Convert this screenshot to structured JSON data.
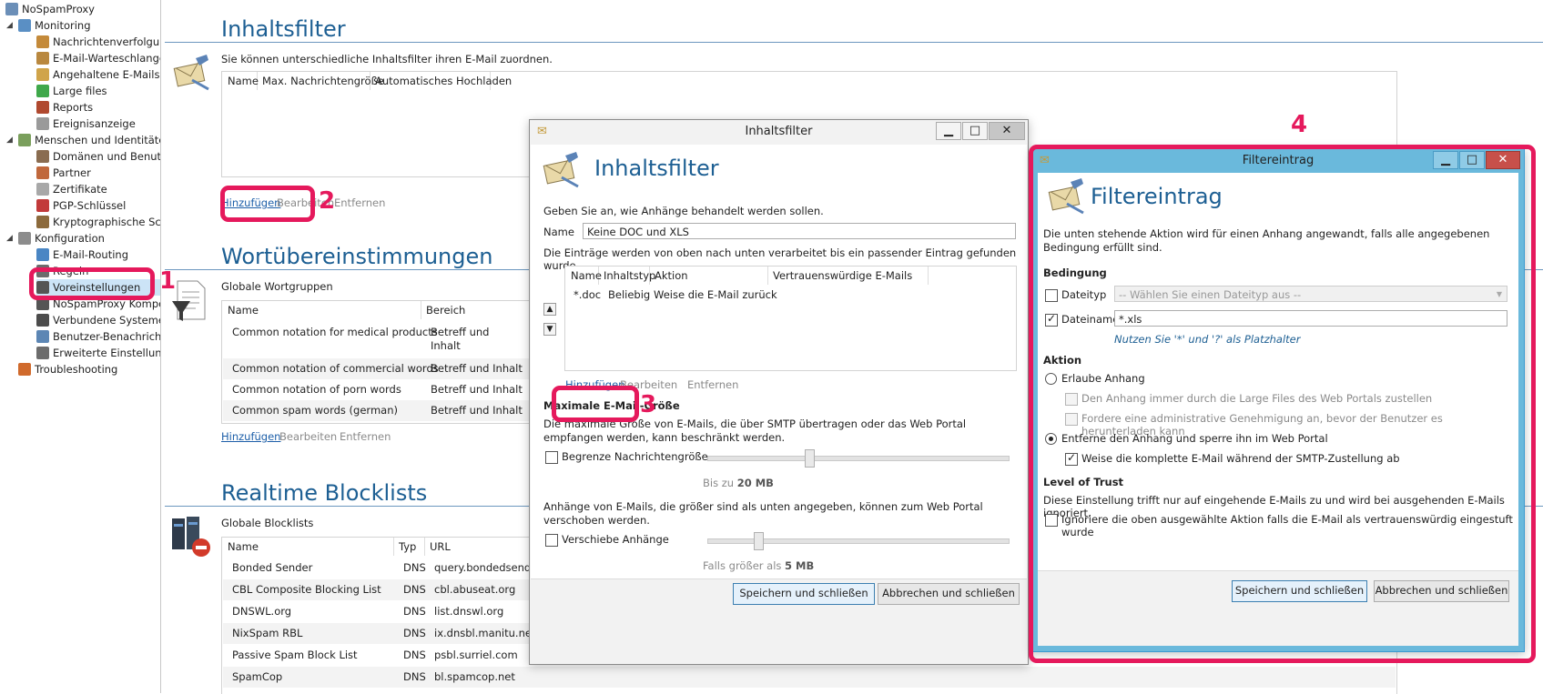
{
  "tree": [
    {
      "label": "NoSpamProxy",
      "indent": 0,
      "color": "#6b8fb8",
      "expander": ""
    },
    {
      "label": "Monitoring",
      "indent": 1,
      "color": "#5a8fc4",
      "expander": "◢"
    },
    {
      "label": "Nachrichtenverfolgung",
      "indent": 2,
      "color": "#c48a3a",
      "expander": ""
    },
    {
      "label": "E-Mail-Warteschlangen",
      "indent": 2,
      "color": "#b9883f",
      "expander": ""
    },
    {
      "label": "Angehaltene E-Mails",
      "indent": 2,
      "color": "#d0a44a",
      "expander": ""
    },
    {
      "label": "Large files",
      "indent": 2,
      "color": "#3fa84a",
      "expander": ""
    },
    {
      "label": "Reports",
      "indent": 2,
      "color": "#b0492f",
      "expander": ""
    },
    {
      "label": "Ereignisanzeige",
      "indent": 2,
      "color": "#9a9a9a",
      "expander": ""
    },
    {
      "label": "Menschen und Identitäten",
      "indent": 1,
      "color": "#7a9f5c",
      "expander": "◢"
    },
    {
      "label": "Domänen und Benutzer",
      "indent": 2,
      "color": "#8a6c50",
      "expander": ""
    },
    {
      "label": "Partner",
      "indent": 2,
      "color": "#c0683c",
      "expander": ""
    },
    {
      "label": "Zertifikate",
      "indent": 2,
      "color": "#a8a8a8",
      "expander": ""
    },
    {
      "label": "PGP-Schlüssel",
      "indent": 2,
      "color": "#c23a3a",
      "expander": ""
    },
    {
      "label": "Kryptographische Schlüssel",
      "indent": 2,
      "color": "#8c6a3c",
      "expander": ""
    },
    {
      "label": "Konfiguration",
      "indent": 1,
      "color": "#8c8c8c",
      "expander": "◢"
    },
    {
      "label": "E-Mail-Routing",
      "indent": 2,
      "color": "#4a86c4",
      "expander": ""
    },
    {
      "label": "Regeln",
      "indent": 2,
      "color": "#6c6c6c",
      "expander": ""
    },
    {
      "label": "Voreinstellungen",
      "indent": 2,
      "color": "#555555",
      "expander": "",
      "selected": true
    },
    {
      "label": "NoSpamProxy Komponenten",
      "indent": 2,
      "color": "#555555",
      "expander": ""
    },
    {
      "label": "Verbundene Systeme",
      "indent": 2,
      "color": "#4c4c4c",
      "expander": ""
    },
    {
      "label": "Benutzer-Benachrichtigungen",
      "indent": 2,
      "color": "#5c86b4",
      "expander": ""
    },
    {
      "label": "Erweiterte Einstellungen",
      "indent": 2,
      "color": "#6c6c6c",
      "expander": ""
    },
    {
      "label": "Troubleshooting",
      "indent": 1,
      "color": "#d06a2c",
      "expander": ""
    }
  ],
  "main": {
    "inhaltsfilter": {
      "title": "Inhaltsfilter",
      "description": "Sie können unterschiedliche Inhaltsfilter ihren E-Mail zuordnen.",
      "columns": [
        "Name",
        "Max. Nachrichtengröße",
        "Automatisches Hochladen"
      ],
      "add": "Hinzufügen",
      "edit": "Bearbeiten",
      "remove": "Entfernen"
    },
    "wort": {
      "title": "Wortübereinstimmungen",
      "subtitle": "Globale Wortgruppen",
      "columns": [
        "Name",
        "Bereich"
      ],
      "rows": [
        {
          "name": "Common notation for medical products",
          "scope": "Betreff und Inhalt"
        },
        {
          "name": "Common notation of commercial words",
          "scope": "Betreff und Inhalt"
        },
        {
          "name": "Common notation of porn words",
          "scope": "Betreff und Inhalt"
        },
        {
          "name": "Common spam words (german)",
          "scope": "Betreff und Inhalt"
        }
      ],
      "add": "Hinzufügen",
      "edit": "Bearbeiten",
      "remove": "Entfernen"
    },
    "rbl": {
      "title": "Realtime Blocklists",
      "subtitle": "Globale Blocklists",
      "columns": [
        "Name",
        "Typ",
        "URL"
      ],
      "rows": [
        {
          "name": "Bonded Sender",
          "type": "DNS",
          "url": "query.bondedsender.org"
        },
        {
          "name": "CBL Composite Blocking List",
          "type": "DNS",
          "url": "cbl.abuseat.org"
        },
        {
          "name": "DNSWL.org",
          "type": "DNS",
          "url": "list.dnswl.org"
        },
        {
          "name": "NixSpam RBL",
          "type": "DNS",
          "url": "ix.dnsbl.manitu.net"
        },
        {
          "name": "Passive Spam Block List",
          "type": "DNS",
          "url": "psbl.surriel.com"
        },
        {
          "name": "SpamCop",
          "type": "DNS",
          "url": "bl.spamcop.net"
        }
      ]
    }
  },
  "dialog1": {
    "window_title": "Inhaltsfilter",
    "heading": "Inhaltsfilter",
    "intro": "Geben Sie an, wie Anhänge behandelt werden sollen.",
    "name_label": "Name",
    "name_value": "Keine DOC und XLS",
    "order_text": "Die Einträge werden von oben nach unten verarbeitet bis ein passender Eintrag gefunden wurde.",
    "columns": [
      "Name",
      "Inhaltstyp",
      "Aktion",
      "Vertrauenswürdige E-Mails"
    ],
    "rows": [
      {
        "name": "*.doc",
        "type": "Beliebig",
        "action": "Weise die E-Mail zurück",
        "trusted": ""
      }
    ],
    "add": "Hinzufügen",
    "edit": "Bearbeiten",
    "remove": "Entfernen",
    "max_heading": "Maximale E-Mail-Größe",
    "max_text": "Die maximale Größe von E-Mails, die über SMTP übertragen oder das Web Portal empfangen werden, kann beschränkt werden.",
    "limit_label": "Begrenze Nachrichtengröße",
    "limit_prefix": "Bis zu ",
    "limit_value": "20 MB",
    "limit_fraction": 0.34,
    "attach_text": "Anhänge von E-Mails, die größer sind als unten angegeben, können zum Web Portal verschoben werden.",
    "move_label": "Verschiebe Anhänge",
    "move_prefix": "Falls größer als ",
    "move_value": "5 MB",
    "move_fraction": 0.17,
    "save": "Speichern und schließen",
    "cancel": "Abbrechen und schließen",
    "min": "▁",
    "max": "□",
    "close": "✕"
  },
  "dialog2": {
    "window_title": "Filtereintrag",
    "heading": "Filtereintrag",
    "intro": "Die unten stehende Aktion wird für einen Anhang angewandt, falls alle angegebenen Bedingung erfüllt sind.",
    "cond_heading": "Bedingung",
    "filetype_label": "Dateityp",
    "filetype_placeholder": "-- Wählen Sie einen Dateityp aus --",
    "filename_label": "Dateiname",
    "filename_value": "*.xls",
    "wildcard_hint": "Nutzen Sie '*' und '?' als Platzhalter",
    "action_heading": "Aktion",
    "allow_label": "Erlaube Anhang",
    "large_files_label": "Den Anhang immer durch die Large Files des Web Portals zustellen",
    "approval_label": "Fordere eine administrative Genehmigung an, bevor der Benutzer es herunterladen kann",
    "remove_label": "Entferne den Anhang und sperre ihn im Web Portal",
    "reject_label": "Weise die komplette E-Mail während der SMTP-Zustellung ab",
    "trust_heading": "Level of Trust",
    "trust_text": "Diese Einstellung trifft nur auf eingehende E-Mails zu und wird bei ausgehenden E-Mails ignoriert.",
    "ignore_label": "Ignoriere die oben ausgewählte Aktion falls die E-Mail als vertrauenswürdig eingestuft wurde",
    "save": "Speichern und schließen",
    "cancel": "Abbrechen und schließen",
    "min": "▁",
    "max": "□",
    "close": "✕"
  },
  "annotations": {
    "n1": "1",
    "n2": "2",
    "n3": "3",
    "n4": "4"
  },
  "colors": {
    "accent": "#1d5f93",
    "highlight": "#e5195c",
    "titlebar_active": "#6ab9dc"
  }
}
